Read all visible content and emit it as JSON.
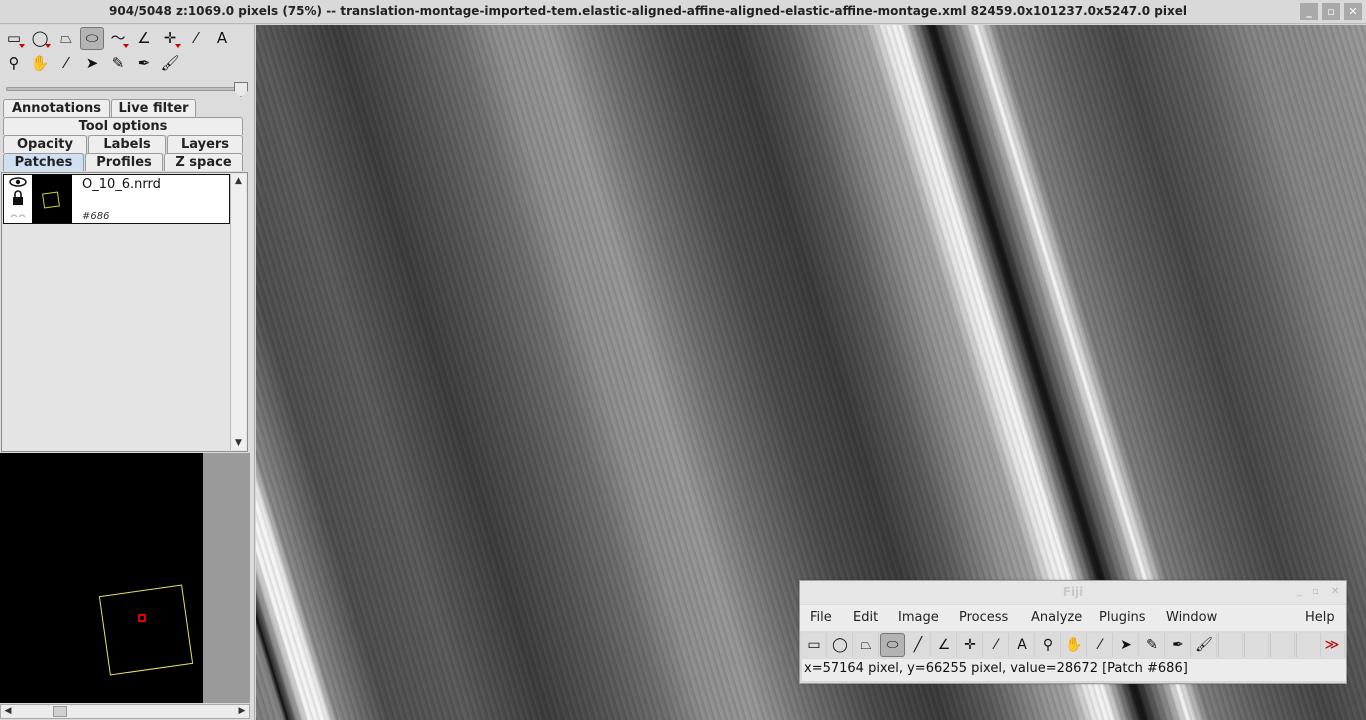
{
  "window": {
    "title": "904/5048   z:1069.0 pixels   (75%) -- translation-montage-imported-tem.elastic-aligned-affine-aligned-elastic-affine-montage.xml   82459.0x101237.0x5247.0 pixel"
  },
  "toolbar": {
    "tools": [
      "rectangle-icon",
      "oval-icon",
      "polygon-icon",
      "freehand-icon",
      "freeline-icon",
      "angle-icon",
      "point-icon",
      "wand-icon",
      "text-icon",
      "magnifier-icon",
      "hand-icon",
      "dropper-icon",
      "arrow-icon",
      "pencil-icon",
      "pen-icon",
      "brush-icon"
    ]
  },
  "tabs": {
    "row1": [
      "Annotations",
      "Live filter"
    ],
    "row2": [
      "Tool options"
    ],
    "row3": [
      "Opacity",
      "Labels",
      "Layers"
    ],
    "row4": [
      "Patches",
      "Profiles",
      "Z space"
    ],
    "selected": "Patches"
  },
  "patch": {
    "name": "O_10_6.nrrd",
    "id": "#686"
  },
  "fiji": {
    "title": "Fiji",
    "menu": [
      "File",
      "Edit",
      "Image",
      "Process",
      "Analyze",
      "Plugins",
      "Window",
      "Help"
    ],
    "status": "x=57164 pixel, y=66255 pixel, value=28672 [Patch #686]"
  }
}
